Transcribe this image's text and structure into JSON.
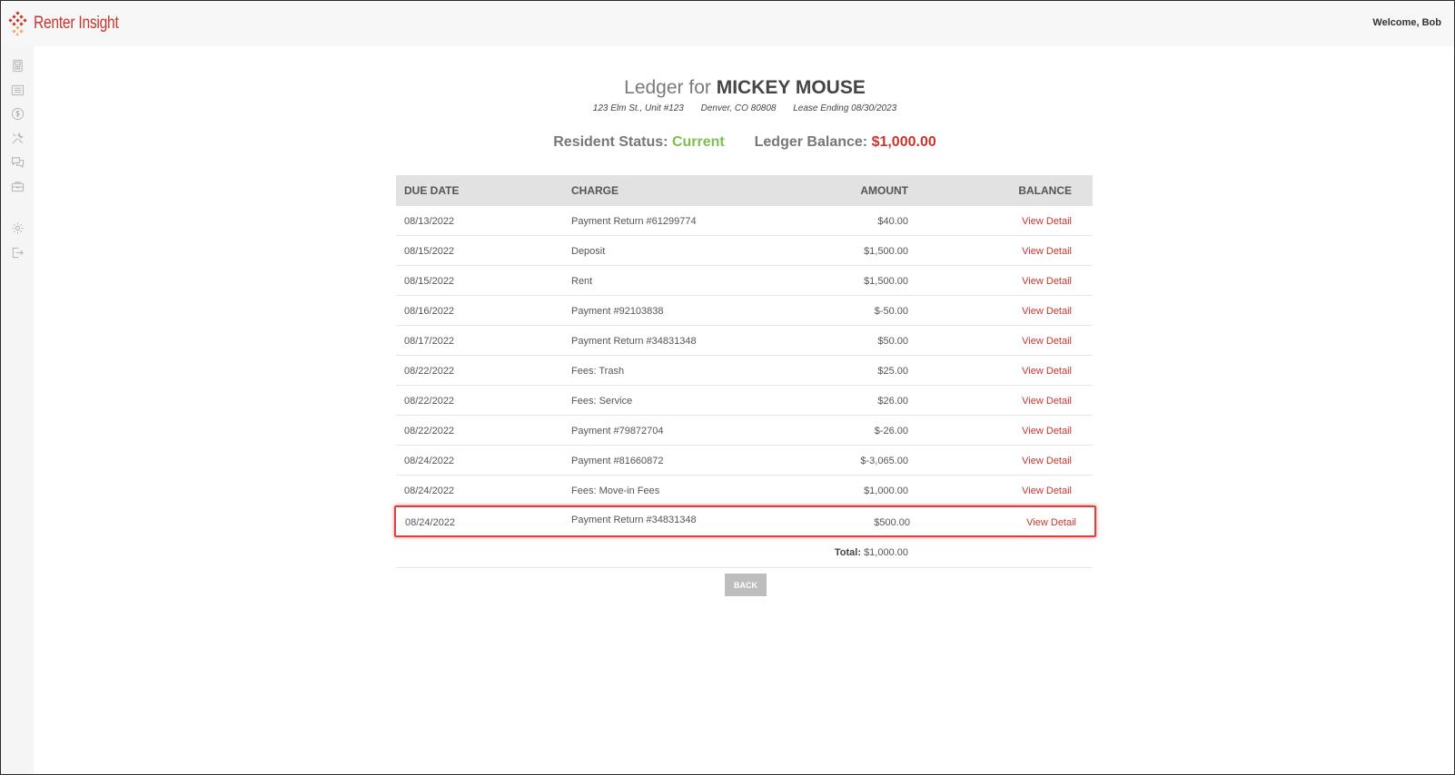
{
  "app": {
    "name": "Renter Insight",
    "welcome": "Welcome, Bob"
  },
  "sidebar": {
    "items": [
      {
        "icon": "calculator-icon"
      },
      {
        "icon": "list-icon"
      },
      {
        "icon": "dollar-icon"
      },
      {
        "icon": "tools-icon"
      },
      {
        "icon": "chat-icon"
      },
      {
        "icon": "briefcase-icon"
      },
      {
        "icon": "gear-icon"
      },
      {
        "icon": "logout-icon"
      }
    ]
  },
  "header": {
    "title_prefix": "Ledger for",
    "resident_name": "MICKEY MOUSE",
    "address": "123 Elm St., Unit #123",
    "city": "Denver, CO 80808",
    "lease": "Lease Ending 08/30/2023",
    "status_label": "Resident Status:",
    "status_value": "Current",
    "balance_label": "Ledger Balance:",
    "balance_value": "$1,000.00"
  },
  "table": {
    "columns": [
      "DUE DATE",
      "CHARGE",
      "AMOUNT",
      "BALANCE"
    ],
    "rows": [
      {
        "date": "08/13/2022",
        "charge": "Payment Return #61299774",
        "amount": "$40.00",
        "link": "View Detail"
      },
      {
        "date": "08/15/2022",
        "charge": "Deposit",
        "amount": "$1,500.00",
        "link": "View Detail"
      },
      {
        "date": "08/15/2022",
        "charge": "Rent",
        "amount": "$1,500.00",
        "link": "View Detail"
      },
      {
        "date": "08/16/2022",
        "charge": "Payment #92103838",
        "amount": "$-50.00",
        "link": "View Detail"
      },
      {
        "date": "08/17/2022",
        "charge": "Payment Return #34831348",
        "amount": "$50.00",
        "link": "View Detail"
      },
      {
        "date": "08/22/2022",
        "charge": "Fees: Trash",
        "amount": "$25.00",
        "link": "View Detail"
      },
      {
        "date": "08/22/2022",
        "charge": "Fees: Service",
        "amount": "$26.00",
        "link": "View Detail"
      },
      {
        "date": "08/22/2022",
        "charge": "Payment #79872704",
        "amount": "$-26.00",
        "link": "View Detail"
      },
      {
        "date": "08/24/2022",
        "charge": "Payment #81660872",
        "amount": "$-3,065.00",
        "link": "View Detail"
      },
      {
        "date": "08/24/2022",
        "charge": "Fees: Move-in Fees",
        "amount": "$1,000.00",
        "link": "View Detail"
      },
      {
        "date": "08/24/2022",
        "charge": "Payment Return #34831348",
        "amount": "$500.00",
        "link": "View Detail"
      }
    ],
    "total_label": "Total:",
    "total_value": "$1,000.00"
  },
  "back_label": "BACK",
  "colors": {
    "accent": "#c9352d",
    "status_green": "#7fbf4d",
    "highlight": "#e0403a"
  }
}
